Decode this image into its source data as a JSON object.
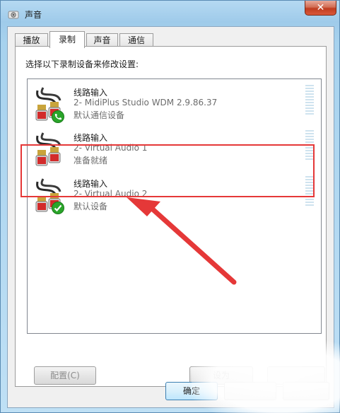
{
  "window": {
    "title": "声音",
    "close_label": "✕"
  },
  "tabs": [
    {
      "label": "播放",
      "active": false
    },
    {
      "label": "录制",
      "active": true
    },
    {
      "label": "声音",
      "active": false
    },
    {
      "label": "通信",
      "active": false
    }
  ],
  "panel": {
    "instruction": "选择以下录制设备来修改设置:"
  },
  "devices": [
    {
      "name": "线路输入",
      "driver": "2- MidiPlus Studio WDM 2.9.86.37",
      "status": "默认通信设备",
      "badge": "phone-icon",
      "selected": false
    },
    {
      "name": "线路输入",
      "driver": "2- Virtual Audio 1",
      "status": "准备就绪",
      "badge": "none",
      "selected": false
    },
    {
      "name": "线路输入",
      "driver": "2- Virtual Audio 2",
      "status": "默认设备",
      "badge": "checkmark-icon",
      "selected": true
    }
  ],
  "buttons": {
    "configure": "配置(C)",
    "set_default": "设为",
    "ok": "确定"
  },
  "colors": {
    "highlight": "#e53838",
    "arrow": "#e53838",
    "badge_green": "#2aa52a"
  }
}
